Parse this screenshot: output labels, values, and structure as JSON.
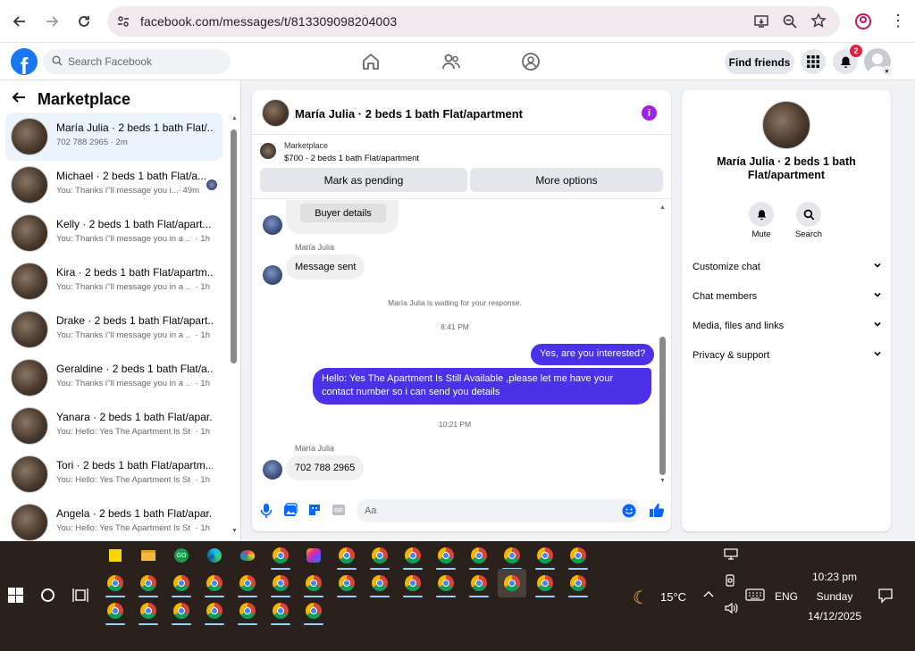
{
  "browser": {
    "url": "facebook.com/messages/t/813309098204003"
  },
  "header": {
    "search_placeholder": "Search Facebook",
    "find_friends": "Find friends",
    "notification_count": "2"
  },
  "sidebar": {
    "title": "Marketplace",
    "conversations": [
      {
        "title": "María Julia · 2 beds 1 bath Flat/...",
        "preview": "702 788 2965 · 2m",
        "time": ""
      },
      {
        "title": "Michael · 2 beds 1 bath Flat/a...",
        "preview": "You: Thanks i''ll message you i...",
        "time": "· 49m"
      },
      {
        "title": "Kelly · 2 beds 1 bath Flat/apart...",
        "preview": "You: Thanks i''ll message you in a ...",
        "time": "· 1h"
      },
      {
        "title": "Kira · 2 beds 1 bath Flat/apartm...",
        "preview": "You: Thanks i''ll message you in a ...",
        "time": "· 1h"
      },
      {
        "title": "Drake · 2 beds 1 bath Flat/apart...",
        "preview": "You: Thanks i''ll message you in a ...",
        "time": "· 1h"
      },
      {
        "title": "Geraldine · 2 beds 1 bath Flat/a...",
        "preview": "You: Thanks i''ll message you in a ...",
        "time": "· 1h"
      },
      {
        "title": "Yanara · 2 beds 1 bath Flat/apar...",
        "preview": "You: Hello: Yes The Apartment Is St...",
        "time": "· 1h"
      },
      {
        "title": "Tori · 2 beds 1 bath Flat/apartm...",
        "preview": "You: Hello: Yes The Apartment Is St...",
        "time": "· 1h"
      },
      {
        "title": "Angela · 2 beds 1 bath Flat/apar...",
        "preview": "You: Hello: Yes The Apartment Is St...",
        "time": "· 1h"
      }
    ]
  },
  "chat": {
    "name": "María Julia · 2 beds 1 bath Flat/apartment",
    "marketplace_label": "Marketplace",
    "listing": "$700 - 2 beds 1 bath Flat/apartment",
    "mark_pending": "Mark as pending",
    "more_options": "More options",
    "buyer_details": "Buyer details",
    "sender_name": "María Julia",
    "msg_sent": "Message sent",
    "waiting_note": "María Julia is waiting for your response.",
    "time1": "8:41 PM",
    "out1": "Yes, are you interested?",
    "out2": "Hello: Yes The Apartment Is Still Available ,please let me have your contact number so i can send you details",
    "time2": "10:21 PM",
    "sender_name2": "María Julia",
    "phone_msg": "702 788 2965",
    "composer_placeholder": "Aa"
  },
  "details": {
    "name": "María Julia · 2 beds 1 bath Flat/apartment",
    "mute": "Mute",
    "search": "Search",
    "rows": [
      "Customize chat",
      "Chat members",
      "Media, files and links",
      "Privacy & support"
    ]
  },
  "taskbar": {
    "temperature": "15°C",
    "language": "ENG",
    "time": "10:23 pm",
    "day": "Sunday",
    "date": "14/12/2025"
  },
  "colors": {
    "fb_blue": "#1877f2",
    "out_bubble": "#4b32e8",
    "info_purple": "#a020f0"
  }
}
